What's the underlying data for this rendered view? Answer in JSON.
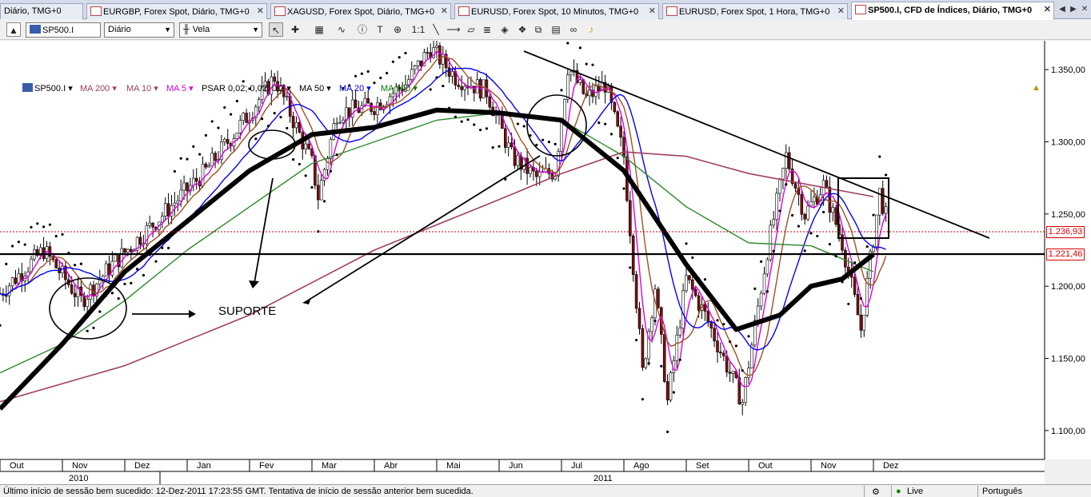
{
  "tabs": [
    {
      "label": "Diário, TMG+0"
    },
    {
      "label": "EURGBP, Forex Spot, Diário, TMG+0"
    },
    {
      "label": "XAGUSD, Forex Spot, Diário, TMG+0"
    },
    {
      "label": "EURUSD, Forex Spot, 10 Minutos, TMG+0"
    },
    {
      "label": "EURUSD, Forex Spot, 1 Hora, TMG+0"
    },
    {
      "label": "SP500.I, CFD de Índices, Diário, TMG+0"
    }
  ],
  "toolbar": {
    "symbol": "SP500.I",
    "period": "Diário",
    "chart_type": "Vela",
    "one_to_one": "1:1"
  },
  "indicators": [
    {
      "label": "SP500.I",
      "color": "#000000"
    },
    {
      "label": "MA 200",
      "color": "#a04060"
    },
    {
      "label": "MA 10",
      "color": "#a04060"
    },
    {
      "label": "MA 5",
      "color": "#e000e0"
    },
    {
      "label": "PSAR 0,02; 0,02; 0,2",
      "color": "#000000"
    },
    {
      "label": "MA 50",
      "color": "#000000"
    },
    {
      "label": "MA 20",
      "color": "#0000ff"
    },
    {
      "label": "MA 100",
      "color": "#008000"
    }
  ],
  "price_tags": {
    "current": "1.236,93",
    "support": "1.221,46"
  },
  "annotation": "SUPORTE",
  "status": {
    "message": "Último início de sessão bem sucedido: 12-Dez-2011 17:23:55 GMT. Tentativa de início de sessão anterior bem sucedida.",
    "mode": "Live",
    "language": "Português"
  },
  "colors": {
    "ma200": "#a04060",
    "ma100": "#2a8a2a",
    "ma50": "#000000",
    "ma20": "#0000ff",
    "ma10": "#a05020",
    "ma5": "#e000e0",
    "current_line": "#d00000"
  },
  "chart_data": {
    "type": "candlestick",
    "title": "SP500.I, CFD de Índices, Diário, TMG+0",
    "x_labels": [
      "Out",
      "Nov",
      "Dez",
      "Jan",
      "Fev",
      "Mar",
      "Abr",
      "Mai",
      "Jun",
      "Jul",
      "Ago",
      "Set",
      "Out",
      "Nov",
      "Dez"
    ],
    "years": [
      "2010",
      "2011"
    ],
    "y_ticks": [
      1100,
      1150,
      1200,
      1250,
      1300,
      1350
    ],
    "y_tick_labels": [
      "1.100,00",
      "1.150,00",
      "1.200,00",
      "1.250,00",
      "1.300,00",
      "1.350,00"
    ],
    "ylim": [
      1080,
      1370
    ],
    "current_price": 1236.93,
    "support_level": 1221.46,
    "trendline_resistance": [
      [
        1,
        1355
      ],
      [
        10.2,
        1238
      ]
    ],
    "trendline_support": [
      [
        5.1,
        1202
      ],
      [
        9.1,
        1290
      ]
    ],
    "series": [
      {
        "name": "MA 200",
        "x": [
          0,
          2,
          4,
          6,
          8,
          9,
          10,
          11,
          12,
          13,
          14
        ],
        "y": [
          1120,
          1145,
          1180,
          1225,
          1260,
          1278,
          1293,
          1290,
          1278,
          1270,
          1262
        ]
      },
      {
        "name": "MA 100",
        "x": [
          0,
          1,
          2,
          3,
          4,
          5,
          6,
          7,
          8,
          9,
          10,
          11,
          12,
          13,
          14
        ],
        "y": [
          1140,
          1160,
          1190,
          1225,
          1255,
          1285,
          1300,
          1315,
          1320,
          1315,
          1290,
          1255,
          1230,
          1228,
          1210
        ]
      },
      {
        "name": "MA 50",
        "x": [
          0,
          1,
          2,
          3,
          4,
          5,
          6,
          7,
          8,
          9,
          10,
          11,
          11.8,
          12.5,
          13,
          13.5,
          14
        ],
        "y": [
          1115,
          1160,
          1210,
          1245,
          1280,
          1305,
          1310,
          1322,
          1320,
          1315,
          1280,
          1215,
          1170,
          1180,
          1200,
          1205,
          1222
        ]
      }
    ]
  }
}
